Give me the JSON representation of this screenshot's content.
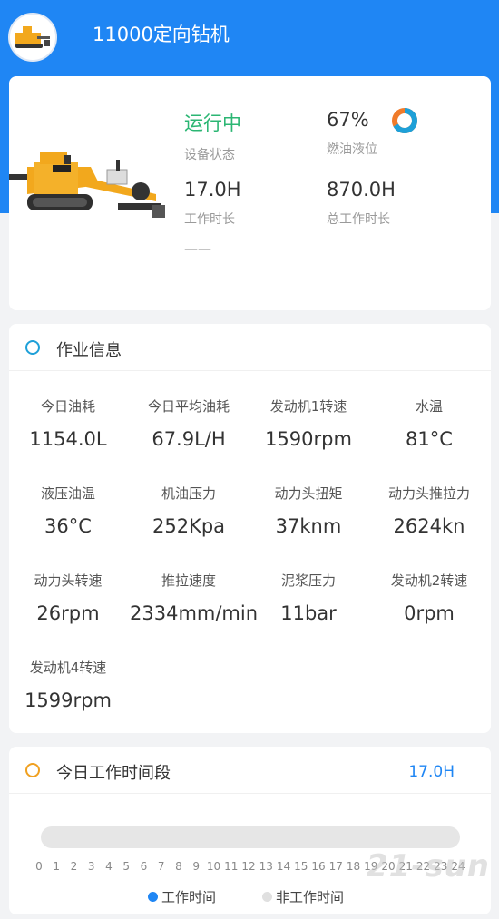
{
  "header": {
    "title": "11000定向钻机"
  },
  "overview": {
    "status_value": "运行中",
    "status_label": "设备状态",
    "fuel_value": "67%",
    "fuel_label": "燃油液位",
    "fuel_level": 0.67,
    "work_hours_value": "17.0H",
    "work_hours_label": "工作时长",
    "total_hours_value": "870.0H",
    "total_hours_label": "总工作时长",
    "extra_value": "——"
  },
  "job_info": {
    "title": "作业信息",
    "metrics": [
      {
        "label": "今日油耗",
        "value": "1154.0L"
      },
      {
        "label": "今日平均油耗",
        "value": "67.9L/H"
      },
      {
        "label": "发动机1转速",
        "value": "1590rpm"
      },
      {
        "label": "水温",
        "value": "81°C"
      },
      {
        "label": "液压油温",
        "value": "36°C"
      },
      {
        "label": "机油压力",
        "value": "252Kpa"
      },
      {
        "label": "动力头扭矩",
        "value": "37knm"
      },
      {
        "label": "动力头推拉力",
        "value": "2624kn"
      },
      {
        "label": "动力头转速",
        "value": "26rpm"
      },
      {
        "label": "推拉速度",
        "value": "2334mm/min"
      },
      {
        "label": "泥浆压力",
        "value": "11bar"
      },
      {
        "label": "发动机2转速",
        "value": "0rpm"
      },
      {
        "label": "发动机4转速",
        "value": "1599rpm"
      }
    ]
  },
  "timeline": {
    "title": "今日工作时间段",
    "hours": "17.0H",
    "ticks": [
      "0",
      "1",
      "2",
      "3",
      "4",
      "5",
      "6",
      "7",
      "8",
      "9",
      "10",
      "11",
      "12",
      "13",
      "14",
      "15",
      "16",
      "17",
      "18",
      "19",
      "20",
      "21",
      "22",
      "23",
      "24"
    ],
    "legend_work": "工作时间",
    "legend_idle": "非工作时间"
  },
  "watermark": "21-sun",
  "colors": {
    "primary": "#1f86f4",
    "running": "#2bb673",
    "ring_job": "#1ea0d8",
    "ring_time": "#f0a020",
    "work_dot": "#1f86f4",
    "idle_dot": "#e0e0e0"
  }
}
